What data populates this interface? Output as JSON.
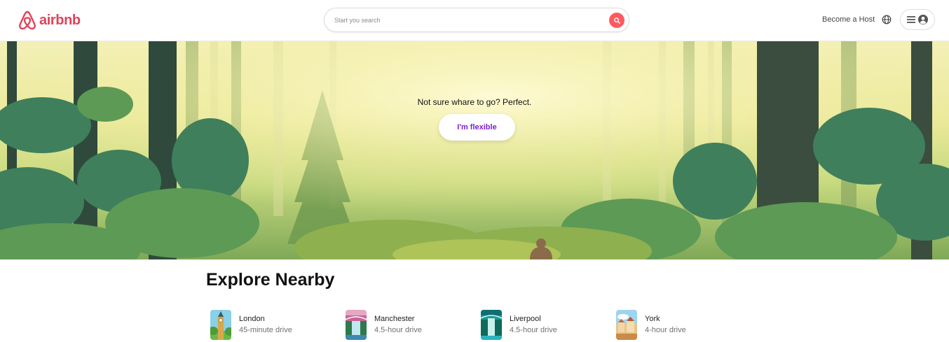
{
  "header": {
    "logo_text": "airbnb",
    "search": {
      "placeholder": "Start you search",
      "value": ""
    },
    "become_host": "Become a Host",
    "brand_color": "#e0435a",
    "search_button_color": "#ff5a5f"
  },
  "hero": {
    "tagline": "Not sure whare to go? Perfect.",
    "button_label": "I'm flexible",
    "button_text_color": "#7a1fd0"
  },
  "explore": {
    "title": "Explore Nearby",
    "places": [
      {
        "name": "London",
        "distance": "45-minute drive",
        "thumb": "big-ben"
      },
      {
        "name": "Manchester",
        "distance": "4.5-hour drive",
        "thumb": "waterfall-bridge"
      },
      {
        "name": "Liverpool",
        "distance": "4.5-hour drive",
        "thumb": "waterfall-teal"
      },
      {
        "name": "York",
        "distance": "4-hour drive",
        "thumb": "villa-town"
      }
    ]
  },
  "icons": [
    "airbnb-logo-icon",
    "search-icon",
    "globe-icon",
    "menu-icon",
    "user-icon"
  ]
}
